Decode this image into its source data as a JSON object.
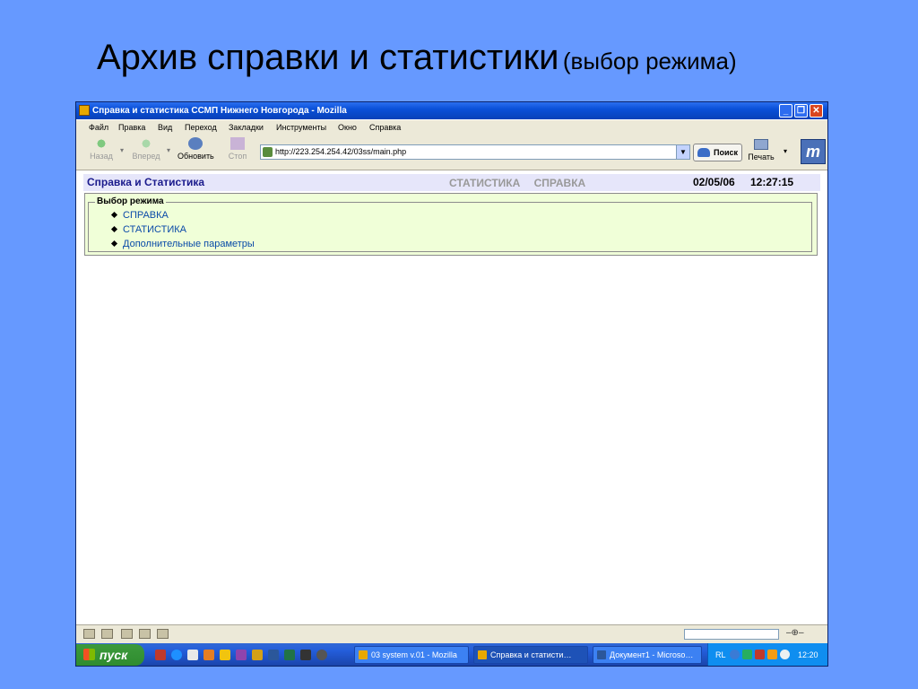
{
  "slide": {
    "title": "Архив справки и статистики",
    "subtitle": "(выбор режима)"
  },
  "window": {
    "title": "Справка и статистика ССМП Нижнего Новгорода - Mozilla",
    "minimize_glyph": "_",
    "maximize_glyph": "❐",
    "close_glyph": "✕"
  },
  "menu": [
    "Файл",
    "Правка",
    "Вид",
    "Переход",
    "Закладки",
    "Инструменты",
    "Окно",
    "Справка"
  ],
  "nav": {
    "back": "Назад",
    "forward": "Вперед",
    "reload": "Обновить",
    "stop": "Стоп",
    "url": "http://223.254.254.42/03ss/main.php",
    "search": "Поиск",
    "print": "Печать",
    "logo_glyph": "m"
  },
  "app": {
    "title": "Справка и Статистика",
    "nav_links": [
      "СТАТИСТИКА",
      "СПРАВКА"
    ],
    "date": "02/05/06",
    "time": "12:27:15",
    "mode_legend": "Выбор режима",
    "options": [
      "СПРАВКА",
      "СТАТИСТИКА",
      "Дополнительные параметры"
    ]
  },
  "statusbar": {
    "plug_glyph": "‒⊕‒"
  },
  "taskbar": {
    "start": "пуск",
    "tasks": [
      "03 system v.01 - Mozilla",
      "Справка и статисти…",
      "Документ1 - Microso…"
    ],
    "active_task_index": 1,
    "language": "RL",
    "clock": "12:20"
  },
  "colors": {
    "desktop_background": "#6699FF",
    "app_header_background": "#E6E6FA",
    "panel_background": "#F0FFD8",
    "link_color": "#0A4AA8",
    "titlebar_blue": "#0A50D8",
    "start_green": "#2F8C2F"
  }
}
